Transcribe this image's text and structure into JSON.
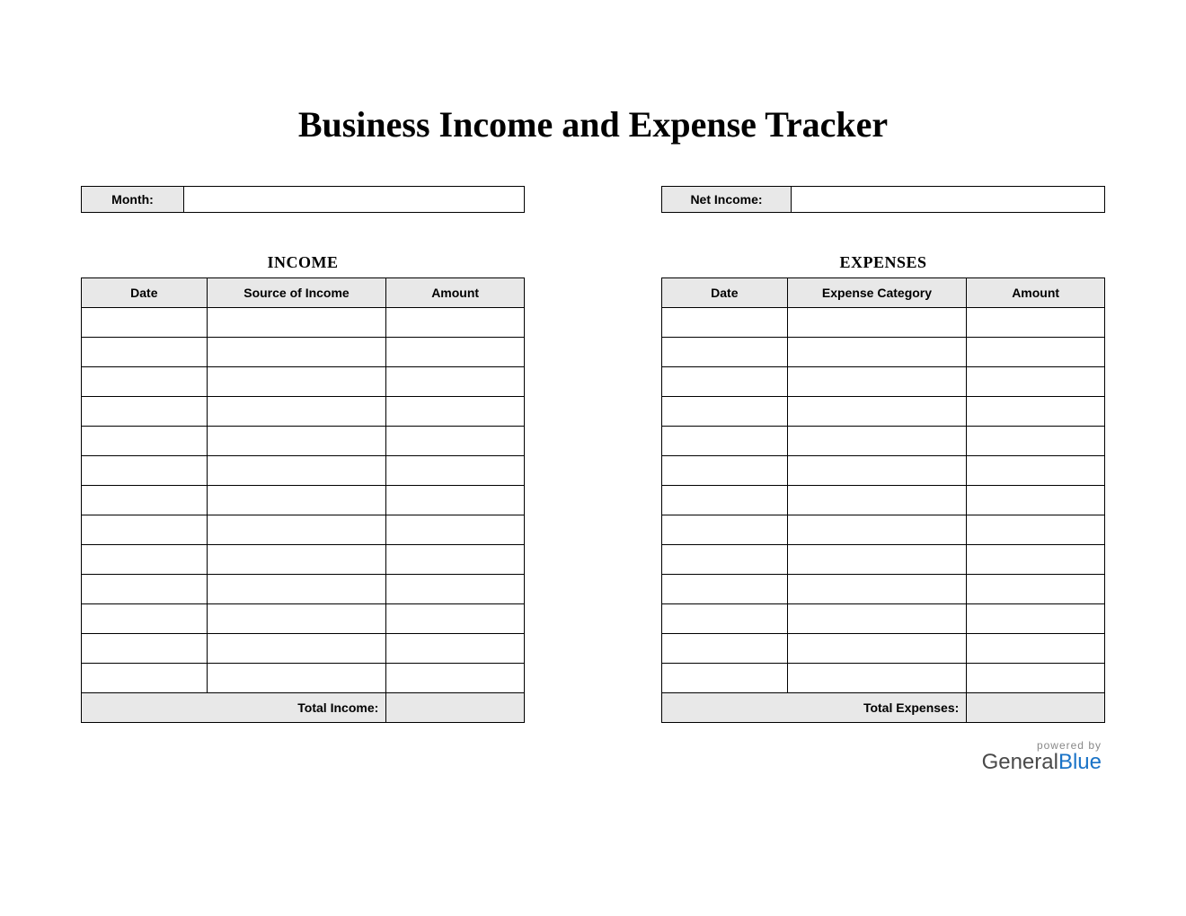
{
  "title": "Business Income and Expense Tracker",
  "meta": {
    "month_label": "Month:",
    "month_value": "",
    "net_income_label": "Net Income:",
    "net_income_value": ""
  },
  "income": {
    "section_title": "INCOME",
    "headers": {
      "date": "Date",
      "source": "Source of Income",
      "amount": "Amount"
    },
    "rows": [
      {
        "date": "",
        "source": "",
        "amount": ""
      },
      {
        "date": "",
        "source": "",
        "amount": ""
      },
      {
        "date": "",
        "source": "",
        "amount": ""
      },
      {
        "date": "",
        "source": "",
        "amount": ""
      },
      {
        "date": "",
        "source": "",
        "amount": ""
      },
      {
        "date": "",
        "source": "",
        "amount": ""
      },
      {
        "date": "",
        "source": "",
        "amount": ""
      },
      {
        "date": "",
        "source": "",
        "amount": ""
      },
      {
        "date": "",
        "source": "",
        "amount": ""
      },
      {
        "date": "",
        "source": "",
        "amount": ""
      },
      {
        "date": "",
        "source": "",
        "amount": ""
      },
      {
        "date": "",
        "source": "",
        "amount": ""
      },
      {
        "date": "",
        "source": "",
        "amount": ""
      }
    ],
    "total_label": "Total Income:",
    "total_value": ""
  },
  "expenses": {
    "section_title": "EXPENSES",
    "headers": {
      "date": "Date",
      "category": "Expense Category",
      "amount": "Amount"
    },
    "rows": [
      {
        "date": "",
        "category": "",
        "amount": ""
      },
      {
        "date": "",
        "category": "",
        "amount": ""
      },
      {
        "date": "",
        "category": "",
        "amount": ""
      },
      {
        "date": "",
        "category": "",
        "amount": ""
      },
      {
        "date": "",
        "category": "",
        "amount": ""
      },
      {
        "date": "",
        "category": "",
        "amount": ""
      },
      {
        "date": "",
        "category": "",
        "amount": ""
      },
      {
        "date": "",
        "category": "",
        "amount": ""
      },
      {
        "date": "",
        "category": "",
        "amount": ""
      },
      {
        "date": "",
        "category": "",
        "amount": ""
      },
      {
        "date": "",
        "category": "",
        "amount": ""
      },
      {
        "date": "",
        "category": "",
        "amount": ""
      },
      {
        "date": "",
        "category": "",
        "amount": ""
      }
    ],
    "total_label": "Total Expenses:",
    "total_value": ""
  },
  "footer": {
    "powered_by": "powered by",
    "brand_general": "General",
    "brand_blue": "Blue"
  }
}
